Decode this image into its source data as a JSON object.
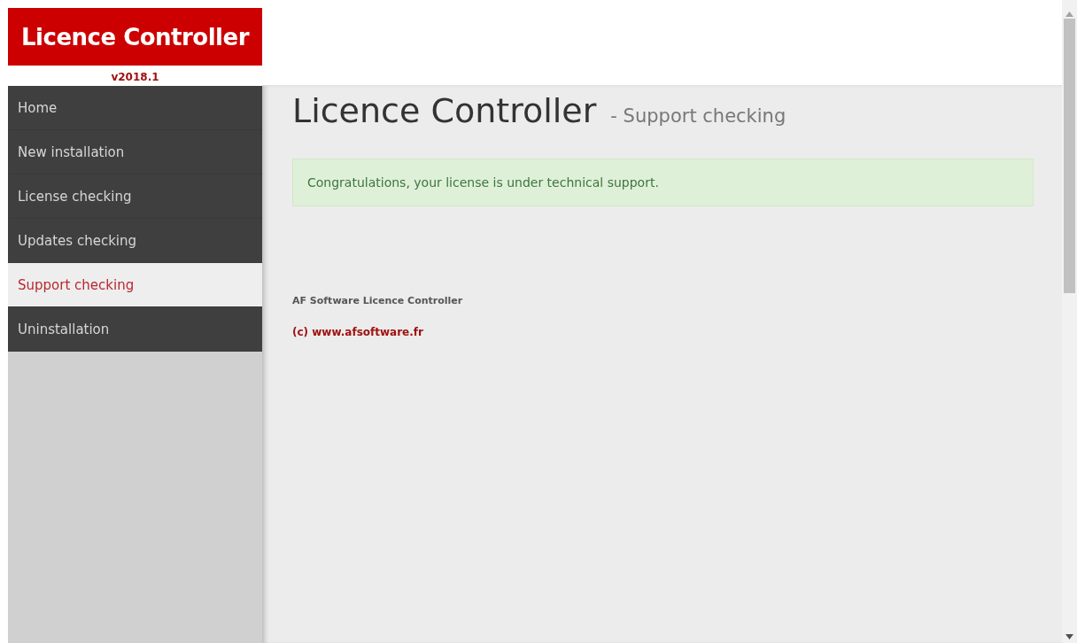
{
  "brand": {
    "title": "Licence Controller",
    "version": "v2018.1"
  },
  "nav": [
    {
      "label": "Home",
      "selected": false
    },
    {
      "label": "New installation",
      "selected": false
    },
    {
      "label": "License checking",
      "selected": false
    },
    {
      "label": "Updates checking",
      "selected": false
    },
    {
      "label": "Support checking",
      "selected": true
    },
    {
      "label": "Uninstallation",
      "selected": false
    }
  ],
  "page": {
    "title": "Licence Controller",
    "subtitle": "- Support checking"
  },
  "alert": {
    "text": "Congratulations, your license is under technical support."
  },
  "footer": {
    "name": "AF Software Licence Controller",
    "copyright": "(c) www.afsoftware.fr"
  }
}
